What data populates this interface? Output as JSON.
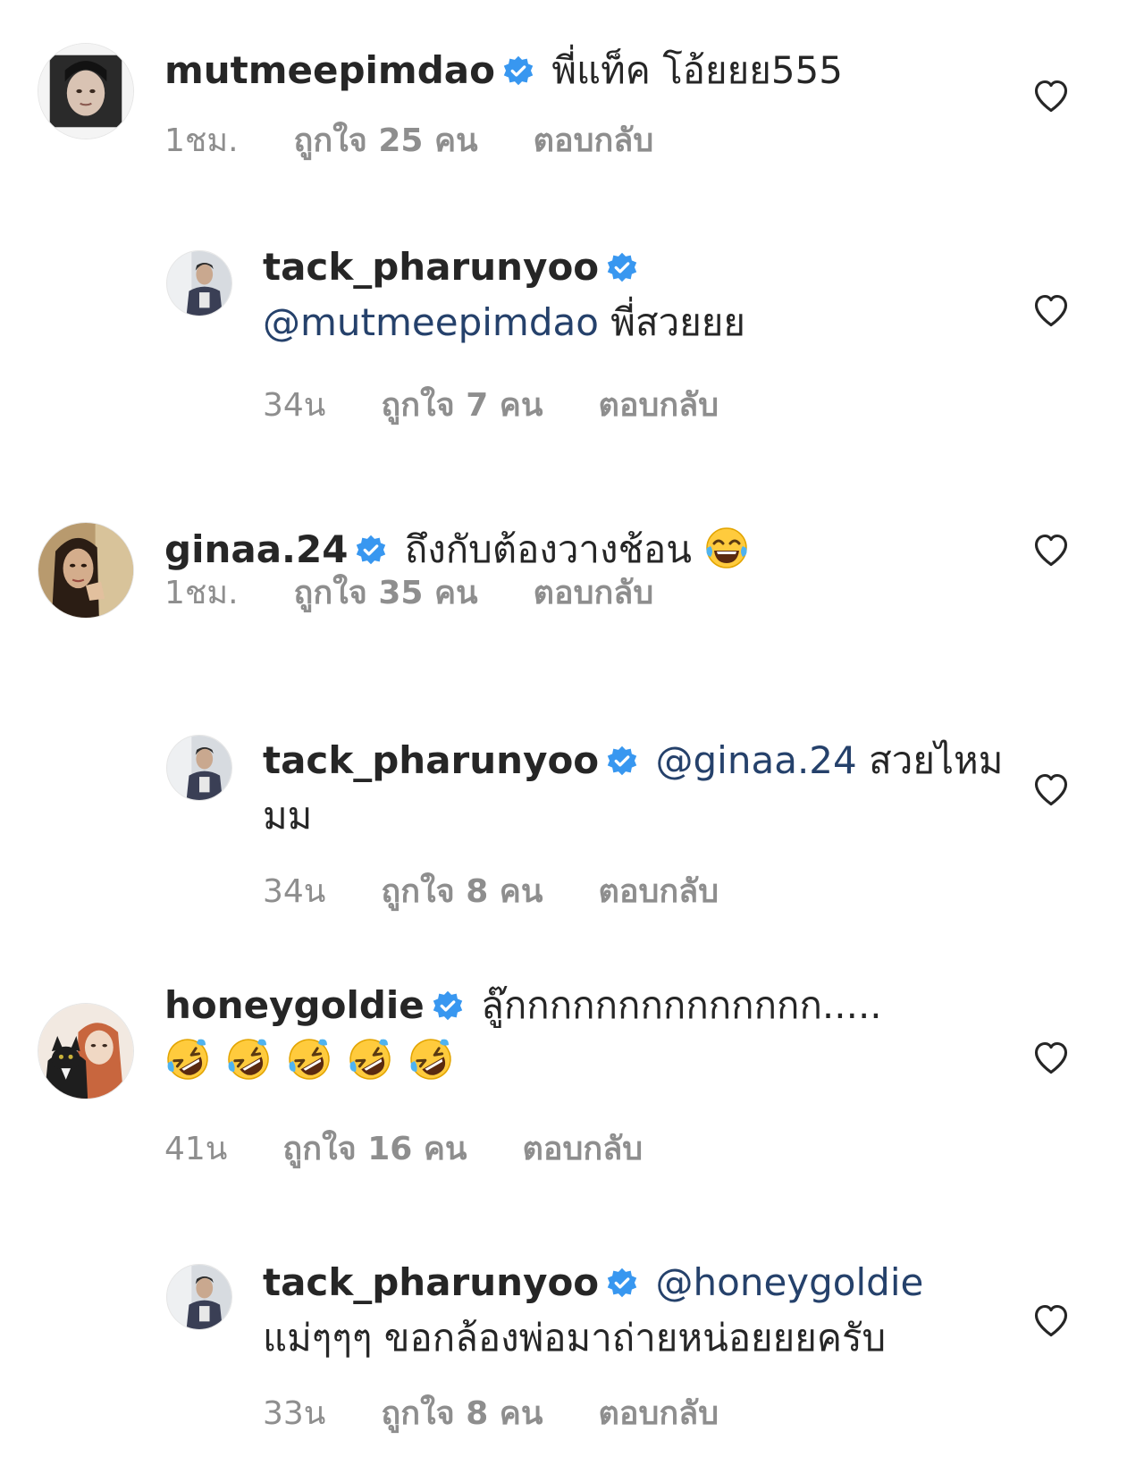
{
  "comments": [
    {
      "username": "mutmeepimdao",
      "avatar": "woman-dark-hair-avatar",
      "mention": "",
      "text": "พี่แท็ค โอ้ยยย555",
      "time": "1ชม.",
      "likes": "ถูกใจ 25 คน",
      "reply": "ตอบกลับ"
    },
    {
      "username": "tack_pharunyoo",
      "avatar": "man-profile-avatar",
      "mention": "@mutmeepimdao",
      "text": "พี่สวยยย",
      "time": "34น",
      "likes": "ถูกใจ 7 คน",
      "reply": "ตอบกลับ"
    },
    {
      "username": "ginaa.24",
      "avatar": "woman-portrait-avatar",
      "mention": "",
      "text": "ถึงกับต้องวางช้อน",
      "emoji": "tears-of-joy-emoji",
      "time": "1ชม.",
      "likes": "ถูกใจ 35 คน",
      "reply": "ตอบกลับ"
    },
    {
      "username": "tack_pharunyoo",
      "avatar": "man-profile-avatar",
      "mention": "@ginaa.24",
      "text": "สวยไหมมม",
      "time": "34น",
      "likes": "ถูกใจ 8 คน",
      "reply": "ตอบกลับ"
    },
    {
      "username": "honeygoldie",
      "avatar": "woman-with-cat-avatar",
      "mention": "",
      "text": "ลู๊กกกกกกกกกกกกกก.....",
      "emoji": "rolling-on-floor-laughing-emoji",
      "emoji_count": 5,
      "time": "41น",
      "likes": "ถูกใจ 16 คน",
      "reply": "ตอบกลับ"
    },
    {
      "username": "tack_pharunyoo",
      "avatar": "man-profile-avatar",
      "mention": "@honeygoldie",
      "text": "แม่ๆๆๆ ขอกล้องพ่อมาถ่ายหน่อยยยครับ",
      "time": "33น",
      "likes": "ถูกใจ 8 คน",
      "reply": "ตอบกลับ"
    }
  ],
  "colors": {
    "username": "#262626",
    "mention": "#25416b",
    "meta": "#8e8e8e",
    "verified": "#3897f0"
  },
  "icons": {
    "verified": "verified-badge-icon",
    "like": "heart-outline-icon"
  }
}
